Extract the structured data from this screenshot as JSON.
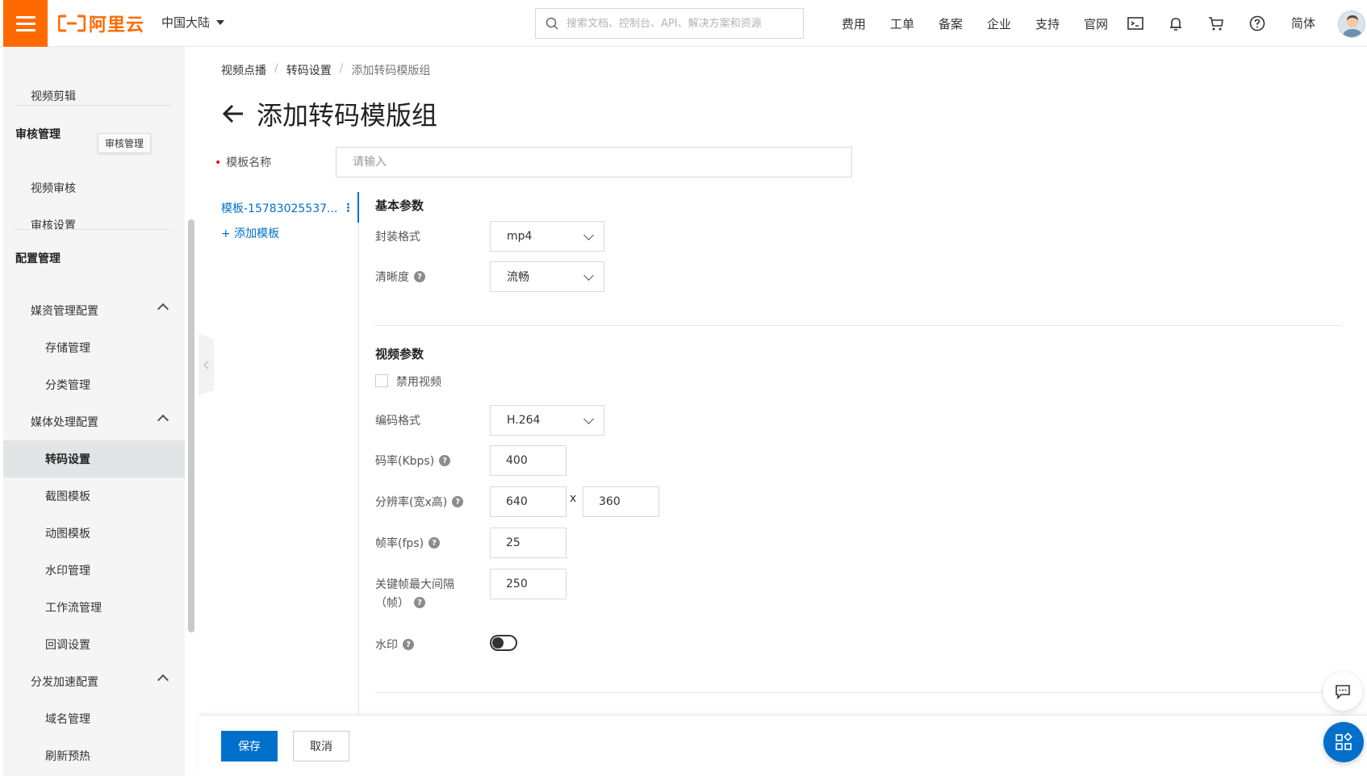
{
  "topbar": {
    "logo_text": "阿里云",
    "region": "中国大陆",
    "search_placeholder": "搜索文档、控制台、API、解决方案和资源",
    "nav": [
      "费用",
      "工单",
      "备案",
      "企业",
      "支持",
      "官网"
    ],
    "language": "简体",
    "brand_color": "#ff6a00"
  },
  "sidebar": {
    "top_item": "视频剪辑",
    "group_review": "审核管理",
    "tooltip": "审核管理",
    "review_items": [
      "视频审核",
      "审核设置"
    ],
    "group_config": "配置管理",
    "media_asset": "媒资管理配置",
    "media_asset_items": [
      "存储管理",
      "分类管理"
    ],
    "media_processing": "媒体处理配置",
    "media_processing_items": [
      "转码设置",
      "截图模板",
      "动图模板",
      "水印管理",
      "工作流管理",
      "回调设置"
    ],
    "cdn": "分发加速配置",
    "cdn_items": [
      "域名管理",
      "刷新预热"
    ]
  },
  "breadcrumb": [
    "视频点播",
    "转码设置",
    "添加转码模版组"
  ],
  "page_title": "添加转码模版组",
  "form": {
    "name_label": "模板名称",
    "name_placeholder": "请输入",
    "template_item": "模板-15783025537...",
    "add_template": "+ 添加模板"
  },
  "basic": {
    "title": "基本参数",
    "container_label": "封装格式",
    "container_value": "mp4",
    "quality_label": "清晰度",
    "quality_value": "流畅"
  },
  "video": {
    "title": "视频参数",
    "disable_label": "禁用视频",
    "codec_label": "编码格式",
    "codec_value": "H.264",
    "bitrate_label": "码率(Kbps)",
    "bitrate_value": "400",
    "resolution_label": "分辨率(宽x高)",
    "width_value": "640",
    "height_value": "360",
    "times": "x",
    "fps_label": "帧率(fps)",
    "fps_value": "25",
    "gop_label_1": "关键帧最大间隔",
    "gop_label_2": "（帧）",
    "gop_value": "250",
    "watermark_label": "水印"
  },
  "footer": {
    "save": "保存",
    "cancel": "取消"
  },
  "colors": {
    "primary": "#0070cc",
    "required": "#e00"
  }
}
